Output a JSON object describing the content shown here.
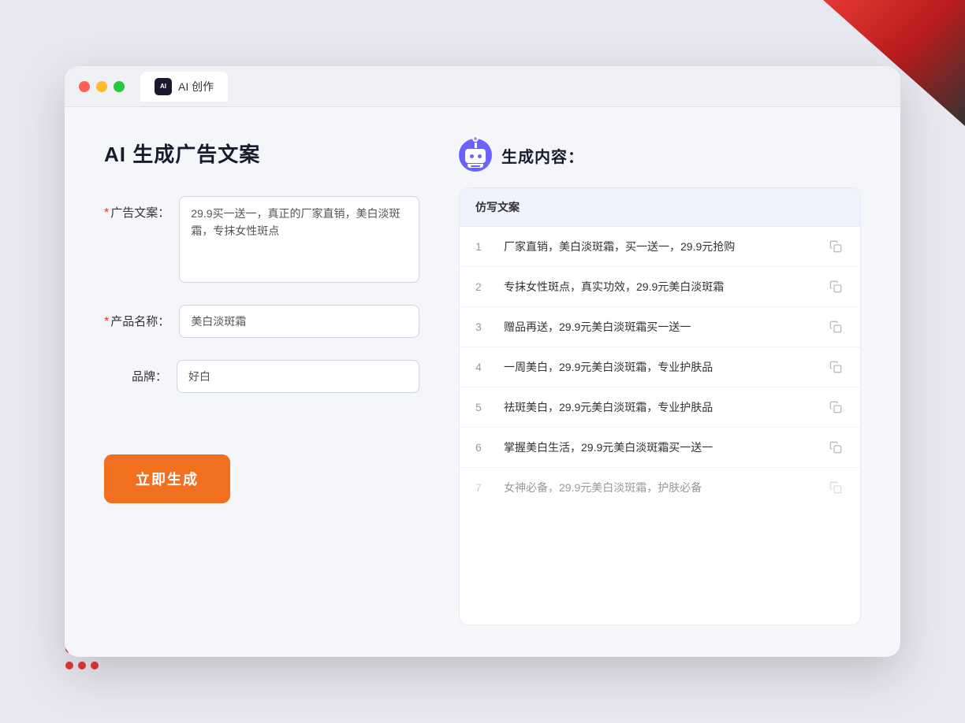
{
  "window": {
    "tab_label": "AI 创作",
    "tab_icon_text": "AI"
  },
  "left_panel": {
    "page_title": "AI 生成广告文案",
    "fields": [
      {
        "id": "ad_copy",
        "label": "广告文案：",
        "required": true,
        "type": "textarea",
        "value": "29.9买一送一，真正的厂家直销，美白淡斑霜，专抹女性斑点"
      },
      {
        "id": "product_name",
        "label": "产品名称：",
        "required": true,
        "type": "input",
        "value": "美白淡斑霜"
      },
      {
        "id": "brand",
        "label": "品牌：",
        "required": false,
        "type": "input",
        "value": "好白"
      }
    ],
    "generate_button_label": "立即生成"
  },
  "right_panel": {
    "header_title": "生成内容：",
    "table_header": "仿写文案",
    "results": [
      {
        "num": "1",
        "text": "厂家直销，美白淡斑霜，买一送一，29.9元抢购",
        "dimmed": false
      },
      {
        "num": "2",
        "text": "专抹女性斑点，真实功效，29.9元美白淡斑霜",
        "dimmed": false
      },
      {
        "num": "3",
        "text": "赠品再送，29.9元美白淡斑霜买一送一",
        "dimmed": false
      },
      {
        "num": "4",
        "text": "一周美白，29.9元美白淡斑霜，专业护肤品",
        "dimmed": false
      },
      {
        "num": "5",
        "text": "祛斑美白，29.9元美白淡斑霜，专业护肤品",
        "dimmed": false
      },
      {
        "num": "6",
        "text": "掌握美白生活，29.9元美白淡斑霜买一送一",
        "dimmed": false
      },
      {
        "num": "7",
        "text": "女神必备，29.9元美白淡斑霜，护肤必备",
        "dimmed": true
      }
    ]
  },
  "colors": {
    "accent_orange": "#f07020",
    "accent_purple": "#6c63ff",
    "required_red": "#e53935"
  }
}
